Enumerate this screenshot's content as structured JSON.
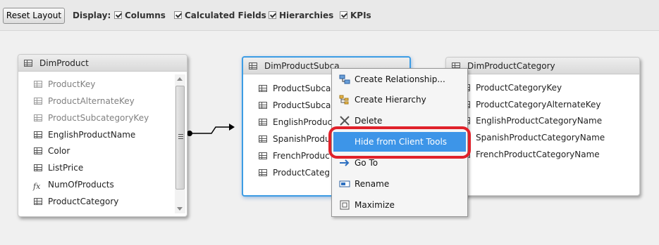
{
  "toolbar": {
    "reset_label": "Reset Layout",
    "display_label": "Display:",
    "options": [
      "Columns",
      "Calculated Fields",
      "Hierarchies",
      "KPIs"
    ]
  },
  "tables": {
    "dim_product": {
      "title": "DimProduct",
      "columns": [
        "ProductKey",
        "ProductAlternateKey",
        "ProductSubcategoryKey",
        "EnglishProductName",
        "Color",
        "ListPrice",
        "NumOfProducts",
        "ProductCategory"
      ]
    },
    "dim_product_subcategory": {
      "title": "DimProductSubca",
      "columns": [
        "ProductSubca",
        "ProductSubca",
        "EnglishProduc",
        "SpanishProduc",
        "FrenchProduc",
        "ProductCateg"
      ]
    },
    "dim_product_category": {
      "title": "DimProductCategory",
      "columns": [
        "ProductCategoryKey",
        "ProductCategoryAlternateKey",
        "EnglishProductCategoryName",
        "SpanishProductCategoryName",
        "FrenchProductCategoryName"
      ]
    }
  },
  "context_menu": {
    "items": [
      "Create Relationship...",
      "Create Hierarchy",
      "Delete",
      "Hide from Client Tools",
      "Go To",
      "Rename",
      "Maximize"
    ]
  },
  "colors": {
    "accent": "#3d95e8",
    "highlight_ring": "#e0212a",
    "selected_border": "#3c9ce4"
  }
}
